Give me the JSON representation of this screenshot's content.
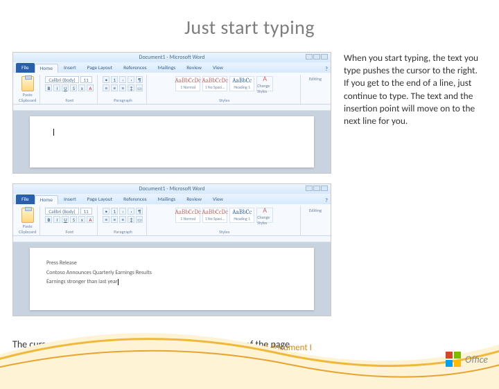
{
  "slide": {
    "title": "Just start typing",
    "caption": "The cursor – a blinking vertical line in the upper-left corner of the page",
    "body": "When you start typing, the text you type pushes the cursor to the right. If you get to the end of a line, just continue to type. The text and the insertion point will move on to the next line for you.",
    "footer": "Create your first Word document I",
    "brand": "Office"
  },
  "word": {
    "title": "Document1 - Microsoft Word",
    "tabs": {
      "file": "File",
      "home": "Home",
      "insert": "Insert",
      "pageLayout": "Page Layout",
      "references": "References",
      "mailings": "Mailings",
      "review": "Review",
      "view": "View"
    },
    "groups": {
      "clipboard": "Clipboard",
      "paste": "Paste",
      "font": "Font",
      "paragraph": "Paragraph",
      "styles": "Styles",
      "editing": "Editing"
    },
    "font": {
      "name": "Calibri (Body)",
      "size": "11"
    },
    "styleSamples": {
      "sample": "AaBbCcDc",
      "headingSample": "AaBbCc",
      "normal": "1 Normal",
      "noSpacing": "1 No Spaci...",
      "heading1": "Heading 1",
      "change": "Change Styles"
    },
    "doc2": {
      "line1": "Press Release",
      "line2": "Contoso Announces Quarterly Earnings Results",
      "line3": "Earnings stronger than last year"
    }
  }
}
